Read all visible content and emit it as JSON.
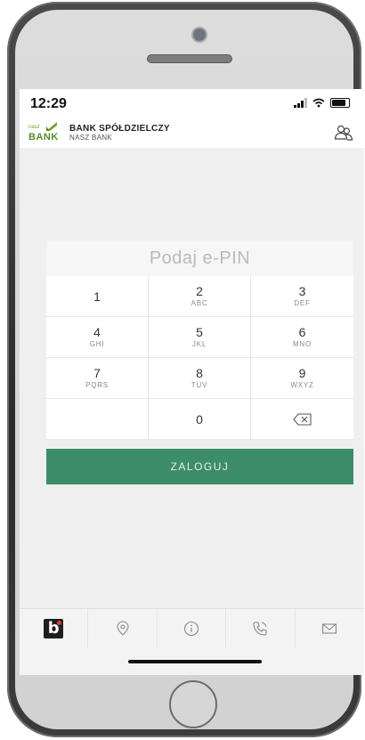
{
  "status_bar": {
    "time": "12:29"
  },
  "header": {
    "logo_small": "nasz",
    "logo_big": "BANK",
    "bank_name": "BANK SPÓŁDZIELCZY",
    "bank_subname": "NASZ BANK"
  },
  "pin": {
    "title": "Podaj e-PIN",
    "keys": [
      {
        "num": "1",
        "letters": ""
      },
      {
        "num": "2",
        "letters": "ABC"
      },
      {
        "num": "3",
        "letters": "DEF"
      },
      {
        "num": "4",
        "letters": "GHI"
      },
      {
        "num": "5",
        "letters": "JKL"
      },
      {
        "num": "6",
        "letters": "MNO"
      },
      {
        "num": "7",
        "letters": "PQRS"
      },
      {
        "num": "8",
        "letters": "TUV"
      },
      {
        "num": "9",
        "letters": "WXYZ"
      },
      {
        "num": "0",
        "letters": ""
      }
    ]
  },
  "login_button": "ZALOGUJ",
  "colors": {
    "accent_green": "#3d8c6a",
    "logo_green": "#4f8f2b"
  },
  "bottom_nav": {
    "items": [
      "b-logo-icon",
      "location-pin-icon",
      "info-icon",
      "phone-icon",
      "envelope-icon"
    ]
  }
}
